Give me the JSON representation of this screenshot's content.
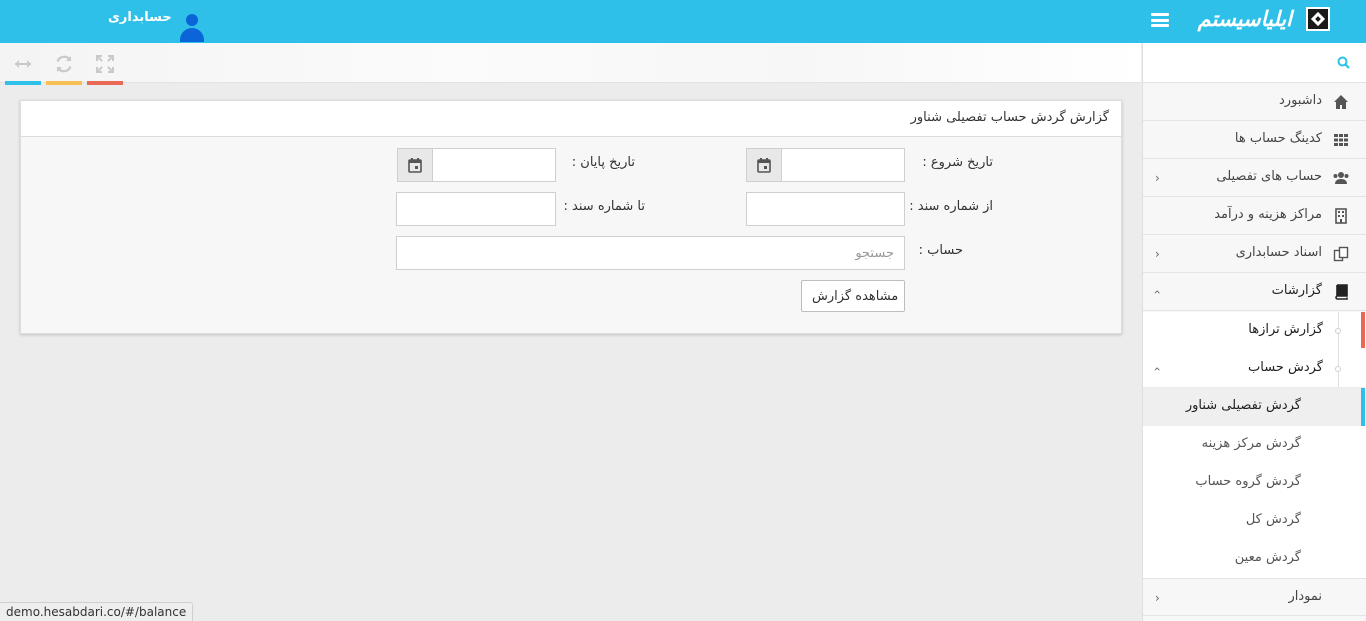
{
  "header": {
    "brand": "ایلیاسیستم",
    "user_name": "حسابداری"
  },
  "toolbar": {
    "tools": [
      {
        "icon": "expand-icon",
        "color": "#e86a56"
      },
      {
        "icon": "refresh-icon",
        "color": "#f5c153"
      },
      {
        "icon": "resize-horizontal-icon",
        "color": "#2ec0e8"
      }
    ]
  },
  "panel": {
    "title": "گزارش گردش حساب تفصیلی شناور",
    "start_date_label": "تاریخ شروع :",
    "end_date_label": "تاریخ پایان :",
    "from_doc_label": "از شماره سند :",
    "to_doc_label": "تا شماره سند :",
    "account_label": "حساب :",
    "account_placeholder": "جستجو",
    "start_date_value": "",
    "end_date_value": "",
    "from_doc_value": "",
    "to_doc_value": "",
    "submit_label": "مشاهده گزارش"
  },
  "sidebar": {
    "search_placeholder": "",
    "items": [
      {
        "label": "داشبورد",
        "icon": "home-icon"
      },
      {
        "label": "کدینگ حساب ها",
        "icon": "grid-icon"
      },
      {
        "label": "حساب های تفصیلی",
        "icon": "users-icon"
      },
      {
        "label": "مراکز هزینه و درآمد",
        "icon": "building-icon"
      },
      {
        "label": "اسناد حسابداری",
        "icon": "copy-icon"
      },
      {
        "label": "گزارشات",
        "icon": "book-icon"
      }
    ],
    "reports_sub": {
      "balance_report": "گزارش ترازها",
      "account_turnover": "گردش حساب",
      "turnover_items": [
        "گردش تفصیلی شناور",
        "گردش مرکز هزینه",
        "گردش گروه حساب",
        "گردش کل",
        "گردش معین"
      ]
    },
    "chart_item": "نمودار"
  },
  "status_bar": {
    "url": "demo.hesabdari.co/#/balance"
  },
  "colors": {
    "topbar": "#2ec0e8",
    "accent_red": "#e86a56",
    "accent_yellow": "#f5c153",
    "accent_blue": "#2ec0e8"
  }
}
